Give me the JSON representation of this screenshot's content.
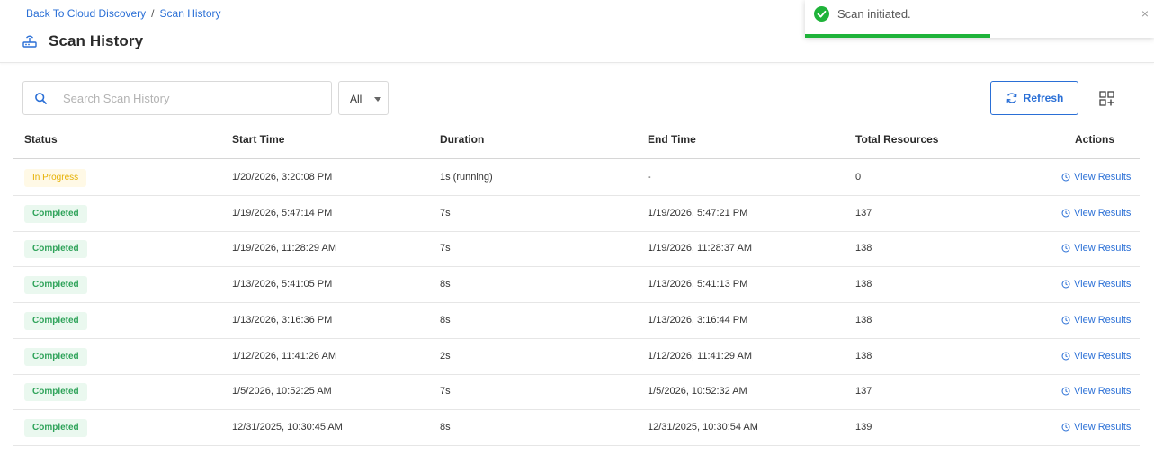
{
  "breadcrumb": {
    "back_label": "Back To Cloud Discovery",
    "separator": "/",
    "current": "Scan History"
  },
  "page": {
    "title": "Scan History",
    "title_icon": "network-device-icon"
  },
  "toast": {
    "message": "Scan initiated.",
    "close": "×",
    "status": "success",
    "color": "#1fb33a",
    "progress": 0.53
  },
  "search": {
    "placeholder": "Search Scan History",
    "value": ""
  },
  "filter": {
    "selected": "All"
  },
  "toolbar": {
    "refresh_label": "Refresh",
    "columns_icon": "grid-add-icon"
  },
  "table": {
    "columns": [
      "Status",
      "Start Time",
      "Duration",
      "End Time",
      "Total Resources",
      "Actions"
    ],
    "action_label": "View Results",
    "rows": [
      {
        "status": "In Progress",
        "start": "1/20/2026, 3:20:08 PM",
        "duration": "1s (running)",
        "end": "-",
        "resources": "0"
      },
      {
        "status": "Completed",
        "start": "1/19/2026, 5:47:14 PM",
        "duration": "7s",
        "end": "1/19/2026, 5:47:21 PM",
        "resources": "137"
      },
      {
        "status": "Completed",
        "start": "1/19/2026, 11:28:29 AM",
        "duration": "7s",
        "end": "1/19/2026, 11:28:37 AM",
        "resources": "138"
      },
      {
        "status": "Completed",
        "start": "1/13/2026, 5:41:05 PM",
        "duration": "8s",
        "end": "1/13/2026, 5:41:13 PM",
        "resources": "138"
      },
      {
        "status": "Completed",
        "start": "1/13/2026, 3:16:36 PM",
        "duration": "8s",
        "end": "1/13/2026, 3:16:44 PM",
        "resources": "138"
      },
      {
        "status": "Completed",
        "start": "1/12/2026, 11:41:26 AM",
        "duration": "2s",
        "end": "1/12/2026, 11:41:29 AM",
        "resources": "138"
      },
      {
        "status": "Completed",
        "start": "1/5/2026, 10:52:25 AM",
        "duration": "7s",
        "end": "1/5/2026, 10:52:32 AM",
        "resources": "137"
      },
      {
        "status": "Completed",
        "start": "12/31/2025, 10:30:45 AM",
        "duration": "8s",
        "end": "12/31/2025, 10:30:54 AM",
        "resources": "139"
      }
    ]
  },
  "colors": {
    "accent": "#2a6fd6",
    "completed_text": "#2fa35a",
    "completed_bg": "#eaf8ef",
    "progress_text": "#e6b000",
    "progress_bg": "#fff9e6"
  }
}
